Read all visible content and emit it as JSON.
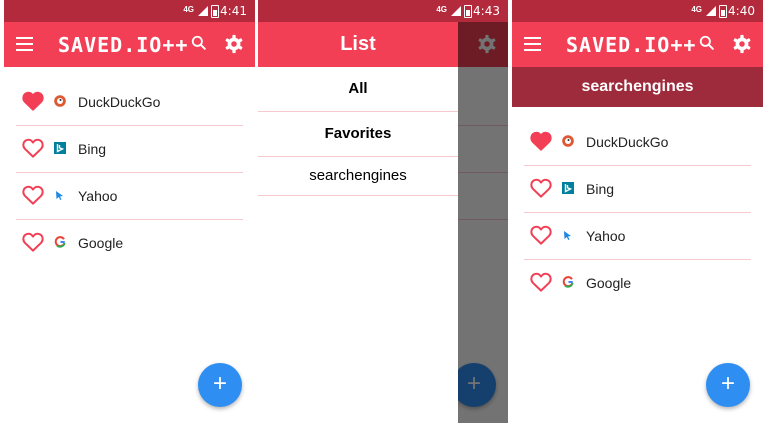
{
  "screens": [
    {
      "status": {
        "network": "4G",
        "time": "4:41"
      },
      "appbar": {
        "title": "SAVED.IO++"
      },
      "list": [
        {
          "name": "DuckDuckGo",
          "favorite": true,
          "icon": "duckduckgo-favicon"
        },
        {
          "name": "Bing",
          "favorite": false,
          "icon": "bing-favicon"
        },
        {
          "name": "Yahoo",
          "favorite": false,
          "icon": "yahoo-favicon"
        },
        {
          "name": "Google",
          "favorite": false,
          "icon": "google-favicon"
        }
      ],
      "fab": "+"
    },
    {
      "status": {
        "network": "4G",
        "time": "4:43"
      },
      "drawer": {
        "title": "List",
        "items": [
          {
            "label": "All",
            "bold": true
          },
          {
            "label": "Favorites",
            "bold": true
          },
          {
            "label": "searchengines",
            "bold": false
          }
        ]
      },
      "fab": "+"
    },
    {
      "status": {
        "network": "4G",
        "time": "4:40"
      },
      "appbar": {
        "title": "SAVED.IO++"
      },
      "subtitle": "searchengines",
      "list": [
        {
          "name": "DuckDuckGo",
          "favorite": true,
          "icon": "duckduckgo-favicon"
        },
        {
          "name": "Bing",
          "favorite": false,
          "icon": "bing-favicon"
        },
        {
          "name": "Yahoo",
          "favorite": false,
          "icon": "yahoo-favicon"
        },
        {
          "name": "Google",
          "favorite": false,
          "icon": "google-favicon"
        }
      ],
      "fab": "+"
    }
  ],
  "colors": {
    "primary": "#f23f55",
    "status_bar": "#b22a3c",
    "subheader": "#9e2b3b",
    "fab": "#2f8ef2",
    "divider": "#f6c9cf"
  }
}
